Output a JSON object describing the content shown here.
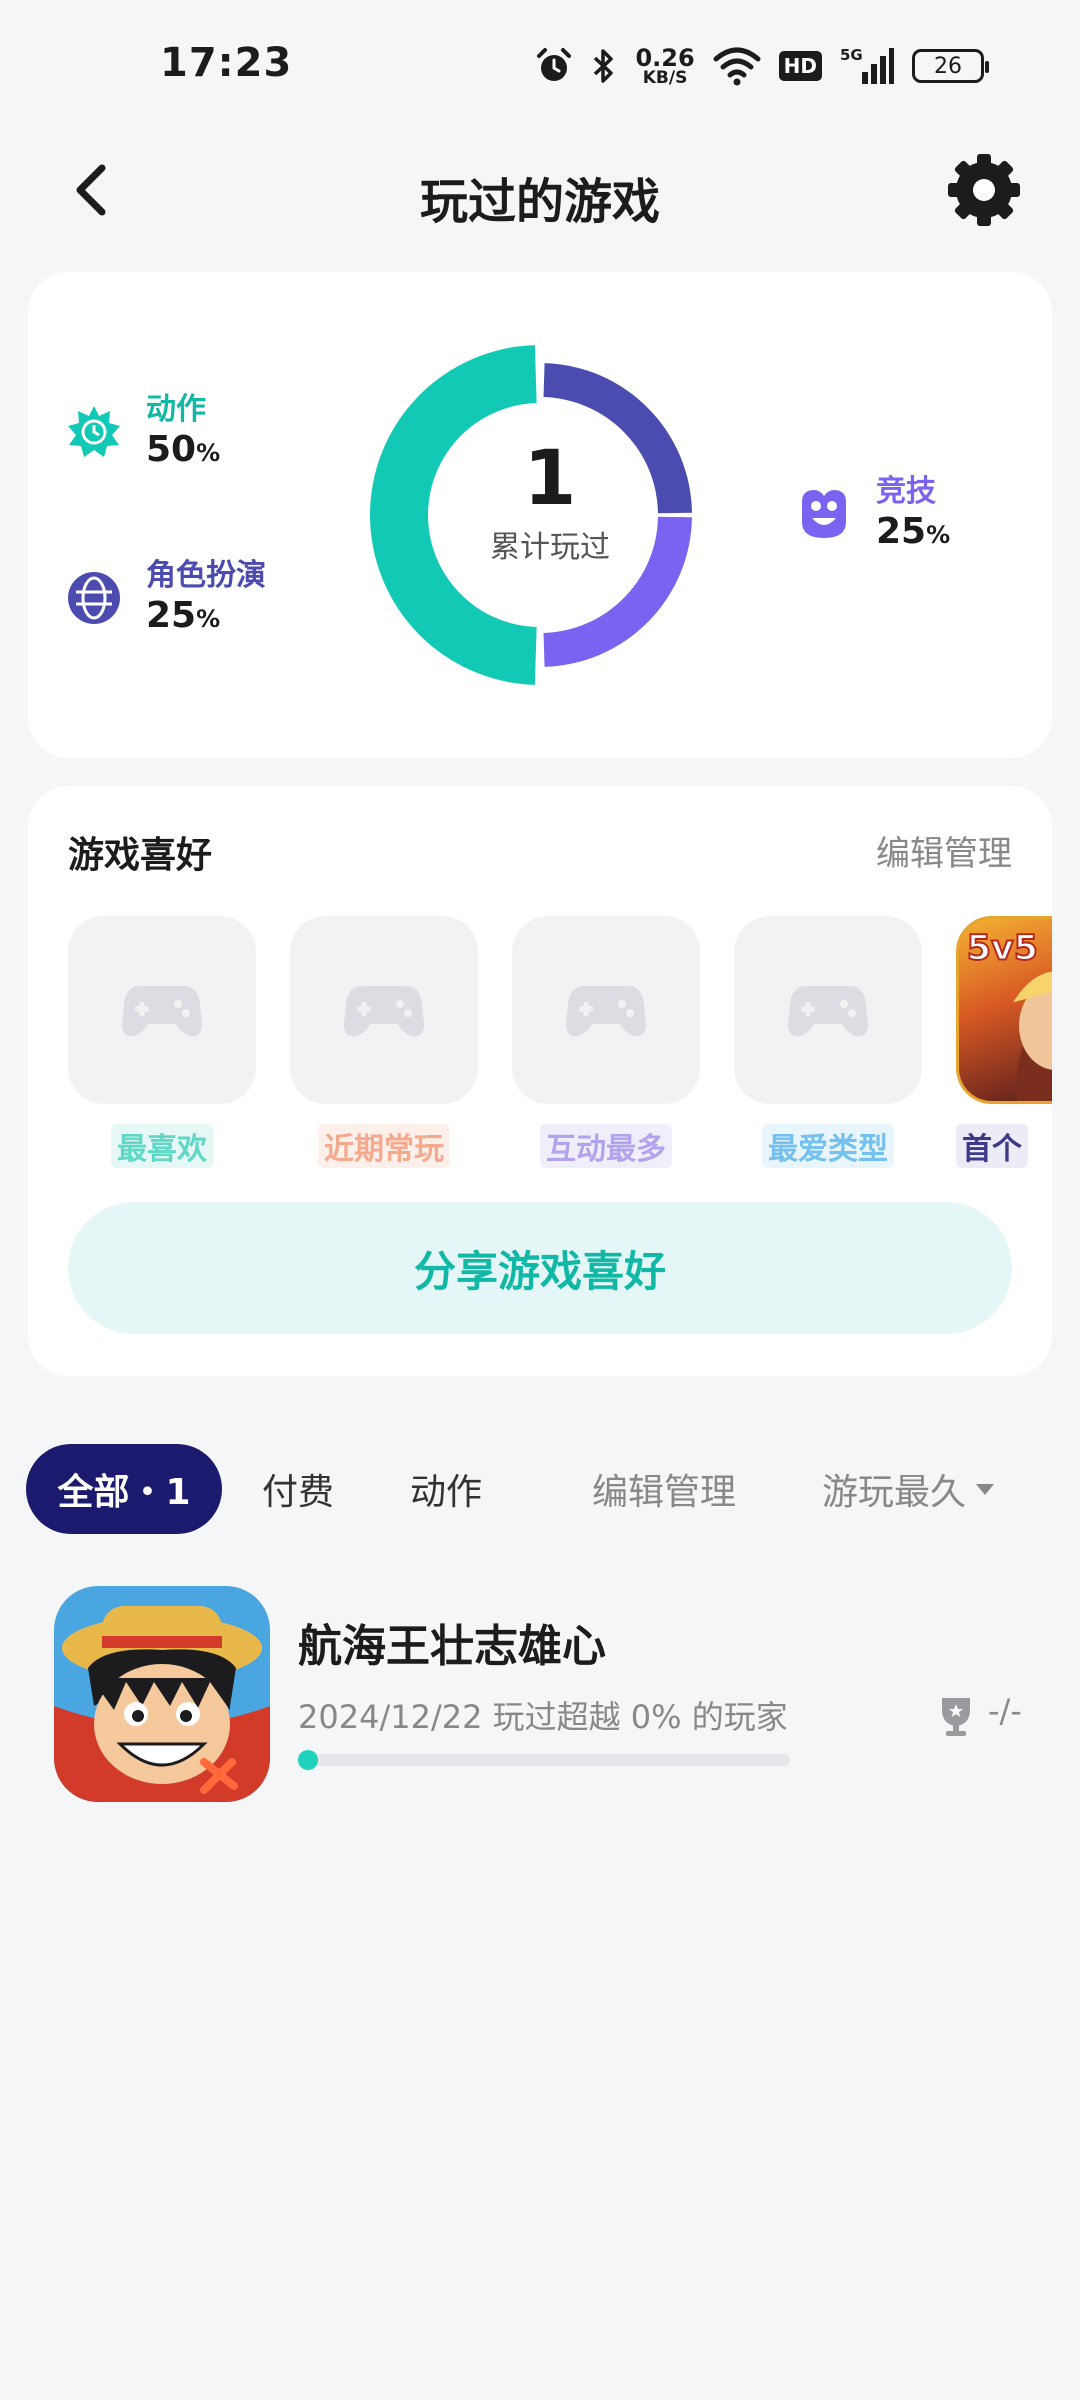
{
  "status_bar": {
    "time": "17:23",
    "speed_value": "0.26",
    "speed_unit": "KB/S",
    "hd": "HD",
    "network": "5G",
    "battery": "26"
  },
  "header": {
    "title": "玩过的游戏"
  },
  "summary": {
    "total": "1",
    "total_label": "累计玩过",
    "categories": [
      {
        "name": "动作",
        "pct": "50",
        "color": "#12c9b5",
        "share": 0.5
      },
      {
        "name": "角色扮演",
        "pct": "25",
        "color": "#4c4cb0",
        "share": 0.25
      },
      {
        "name": "竞技",
        "pct": "25",
        "color": "#7b63f2",
        "share": 0.25
      }
    ],
    "pct_unit": "%"
  },
  "preferences": {
    "title": "游戏喜好",
    "edit": "编辑管理",
    "items": [
      {
        "label": "最喜欢",
        "color": "#5fd8c6",
        "bg": "#e6f8f5"
      },
      {
        "label": "近期常玩",
        "color": "#f6a98d",
        "bg": "#fdf0ea"
      },
      {
        "label": "互动最多",
        "color": "#b3a3ee",
        "bg": "#f1eefc"
      },
      {
        "label": "最爱类型",
        "color": "#74c0ee",
        "bg": "#e9f5fc"
      },
      {
        "label": "首个",
        "color": "#3d3a8a",
        "bg": "#ecebf6",
        "tile_text": "5v5"
      }
    ],
    "share_button": "分享游戏喜好"
  },
  "filters": {
    "all": "全部・1",
    "paid": "付费",
    "action": "动作",
    "edit": "编辑管理",
    "sort": "游玩最久"
  },
  "games": [
    {
      "name": "航海王壮志雄心",
      "meta": "2024/12/22 玩过超越 0% 的玩家",
      "rank": "-/-",
      "progress": 0
    }
  ]
}
